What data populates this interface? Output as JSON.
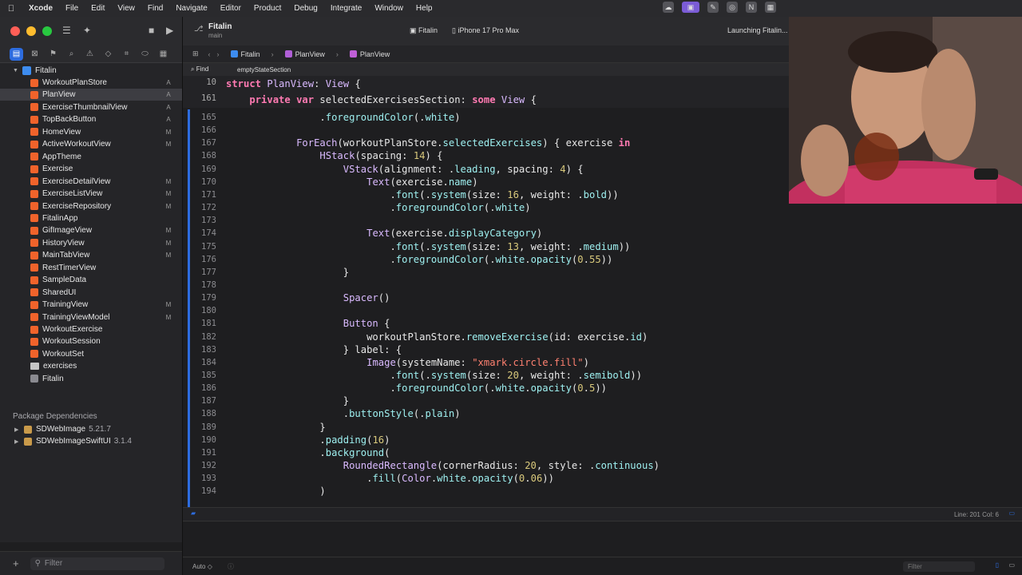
{
  "menubar": {
    "app": "Xcode",
    "items": [
      "File",
      "Edit",
      "View",
      "Find",
      "Navigate",
      "Editor",
      "Product",
      "Debug",
      "Integrate",
      "Window",
      "Help"
    ]
  },
  "toolbar": {
    "project_title": "Fitalin",
    "project_branch": "main",
    "scheme": "Fitalin",
    "device": "iPhone 17 Pro Max",
    "status": "Launching Fitalin..."
  },
  "navigator": {
    "root": "Fitalin",
    "files": [
      {
        "name": "WorkoutPlanStore",
        "badge": "A"
      },
      {
        "name": "PlanView",
        "badge": "A",
        "selected": true
      },
      {
        "name": "ExerciseThumbnailView",
        "badge": "A"
      },
      {
        "name": "TopBackButton",
        "badge": "A"
      },
      {
        "name": "HomeView",
        "badge": "M"
      },
      {
        "name": "ActiveWorkoutView",
        "badge": "M"
      },
      {
        "name": "AppTheme",
        "badge": ""
      },
      {
        "name": "Exercise",
        "badge": ""
      },
      {
        "name": "ExerciseDetailView",
        "badge": "M"
      },
      {
        "name": "ExerciseListView",
        "badge": "M"
      },
      {
        "name": "ExerciseRepository",
        "badge": "M"
      },
      {
        "name": "FitalinApp",
        "badge": ""
      },
      {
        "name": "GifImageView",
        "badge": "M"
      },
      {
        "name": "HistoryView",
        "badge": "M"
      },
      {
        "name": "MainTabView",
        "badge": "M"
      },
      {
        "name": "RestTimerView",
        "badge": ""
      },
      {
        "name": "SampleData",
        "badge": ""
      },
      {
        "name": "SharedUI",
        "badge": ""
      },
      {
        "name": "TrainingView",
        "badge": "M"
      },
      {
        "name": "TrainingViewModel",
        "badge": "M"
      },
      {
        "name": "WorkoutExercise",
        "badge": ""
      },
      {
        "name": "WorkoutSession",
        "badge": ""
      },
      {
        "name": "WorkoutSet",
        "badge": ""
      },
      {
        "name": "exercises",
        "badge": ""
      },
      {
        "name": "Fitalin",
        "badge": ""
      }
    ],
    "packages_header": "Package Dependencies",
    "packages": [
      {
        "name": "SDWebImage",
        "version": "5.21.7"
      },
      {
        "name": "SDWebImageSwiftUI",
        "version": "3.1.4"
      }
    ],
    "filter_placeholder": "Filter"
  },
  "jumpbar": {
    "crumbs": [
      "Fitalin",
      "PlanView",
      "PlanView"
    ]
  },
  "findbar": {
    "label": "Find",
    "query": "emptyStateSection"
  },
  "sticky": [
    {
      "num": "10",
      "text": "struct PlanView: View {"
    },
    {
      "num": "161",
      "text": "    private var selectedExercisesSection: some View {"
    }
  ],
  "code_lines": [
    {
      "num": "165",
      "text": "                .foregroundColor(.white)"
    },
    {
      "num": "166",
      "text": ""
    },
    {
      "num": "167",
      "text": "            ForEach(workoutPlanStore.selectedExercises) { exercise in"
    },
    {
      "num": "168",
      "text": "                HStack(spacing: 14) {"
    },
    {
      "num": "169",
      "text": "                    VStack(alignment: .leading, spacing: 4) {"
    },
    {
      "num": "170",
      "text": "                        Text(exercise.name)"
    },
    {
      "num": "171",
      "text": "                            .font(.system(size: 16, weight: .bold))"
    },
    {
      "num": "172",
      "text": "                            .foregroundColor(.white)"
    },
    {
      "num": "173",
      "text": ""
    },
    {
      "num": "174",
      "text": "                        Text(exercise.displayCategory)"
    },
    {
      "num": "175",
      "text": "                            .font(.system(size: 13, weight: .medium))"
    },
    {
      "num": "176",
      "text": "                            .foregroundColor(.white.opacity(0.55))"
    },
    {
      "num": "177",
      "text": "                    }"
    },
    {
      "num": "178",
      "text": ""
    },
    {
      "num": "179",
      "text": "                    Spacer()"
    },
    {
      "num": "180",
      "text": ""
    },
    {
      "num": "181",
      "text": "                    Button {"
    },
    {
      "num": "182",
      "text": "                        workoutPlanStore.removeExercise(id: exercise.id)"
    },
    {
      "num": "183",
      "text": "                    } label: {"
    },
    {
      "num": "184",
      "text": "                        Image(systemName: \"xmark.circle.fill\")"
    },
    {
      "num": "185",
      "text": "                            .font(.system(size: 20, weight: .semibold))"
    },
    {
      "num": "186",
      "text": "                            .foregroundColor(.white.opacity(0.5))"
    },
    {
      "num": "187",
      "text": "                    }"
    },
    {
      "num": "188",
      "text": "                    .buttonStyle(.plain)"
    },
    {
      "num": "189",
      "text": "                }"
    },
    {
      "num": "190",
      "text": "                .padding(16)"
    },
    {
      "num": "191",
      "text": "                .background("
    },
    {
      "num": "192",
      "text": "                    RoundedRectangle(cornerRadius: 20, style: .continuous)"
    },
    {
      "num": "193",
      "text": "                        .fill(Color.white.opacity(0.06))"
    },
    {
      "num": "194",
      "text": "                )"
    }
  ],
  "statusbar": {
    "line_col": "Line: 201  Col: 6",
    "auto": "Auto",
    "filter_placeholder": "Filter"
  },
  "colors": {
    "keyword": "#ff7ab2",
    "type": "#dabaff",
    "property": "#9ef0f0",
    "number": "#d9c97c",
    "string": "#ff8170",
    "accent": "#2d6cdf"
  }
}
